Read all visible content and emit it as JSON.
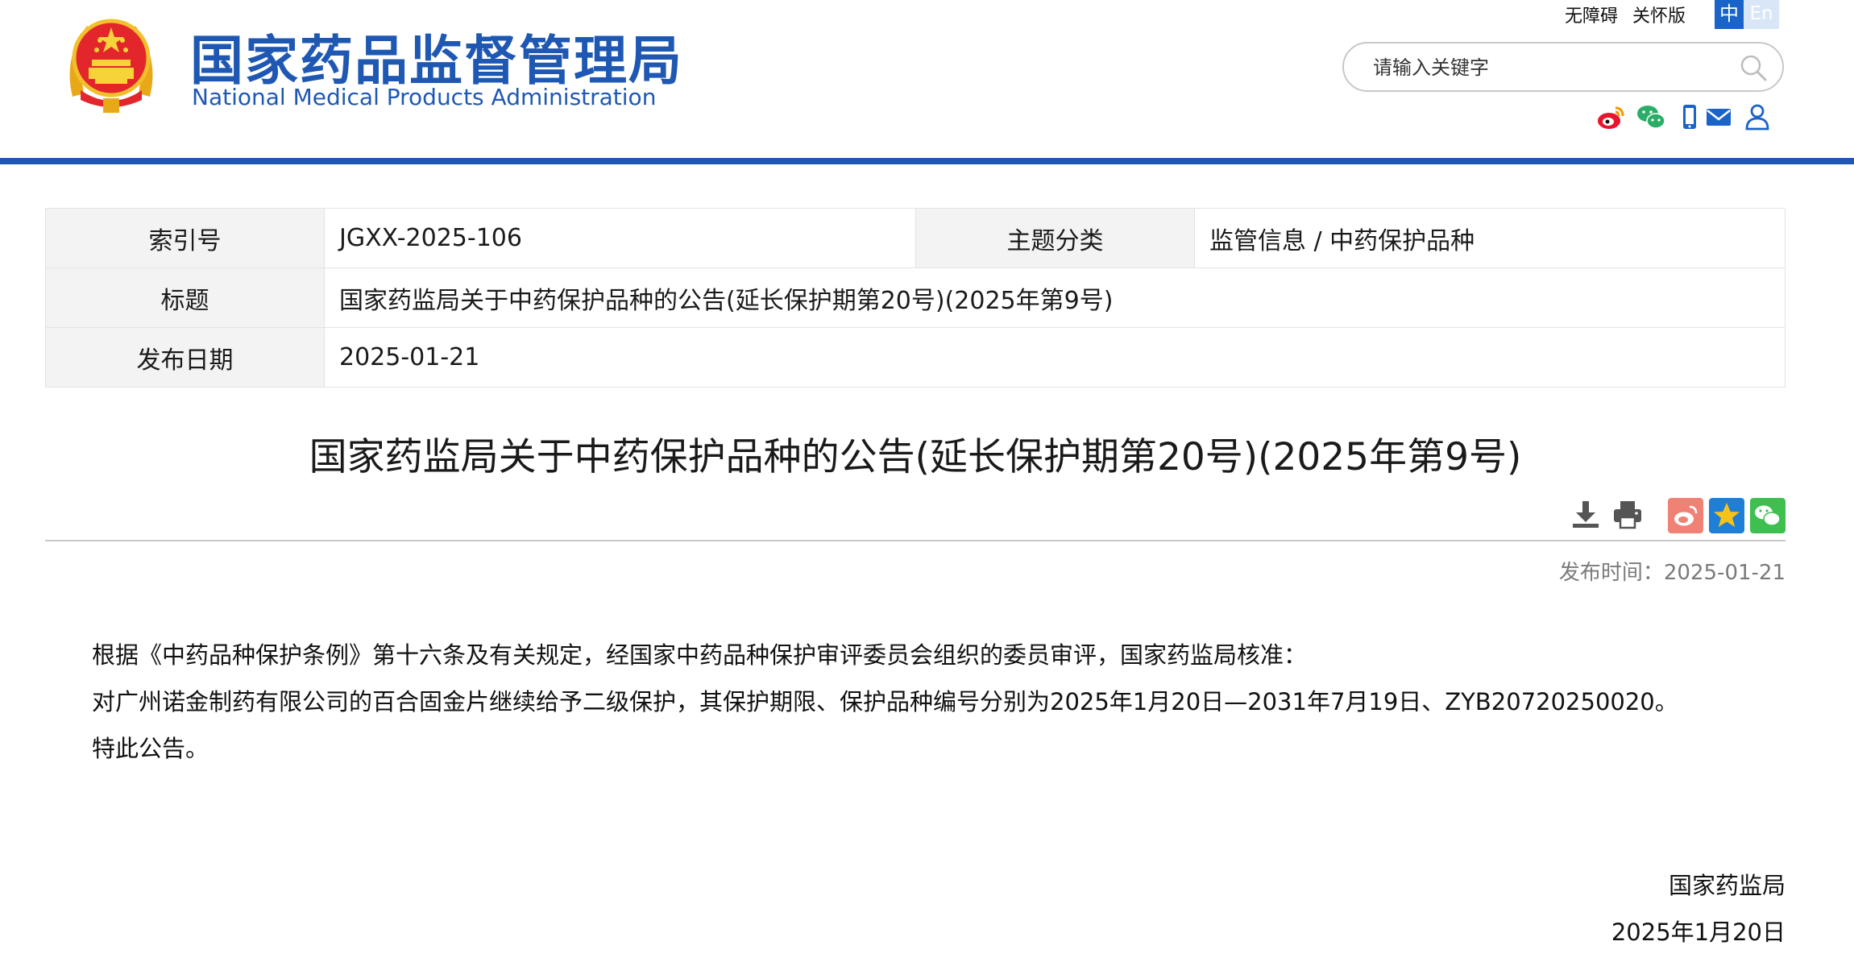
{
  "header": {
    "site_name_cn": "国家药品监督管理局",
    "site_name_en": "National Medical Products Administration",
    "accessibility_link": "无障碍",
    "elderly_link": "关怀版",
    "lang_cn": "中",
    "lang_en": "En",
    "search_placeholder": "请输入关键字",
    "social_icons": [
      "weibo-icon",
      "wechat-icon",
      "mobile-icon",
      "mail-icon",
      "user-icon"
    ],
    "brand_color": "#1f58b3"
  },
  "meta": {
    "index_label": "索引号",
    "index_value": "JGXX-2025-106",
    "topic_label": "主题分类",
    "topic_value": "监管信息 / 中药保护品种",
    "title_label": "标题",
    "title_value": "国家药监局关于中药保护品种的公告(延长保护期第20号)(2025年第9号)",
    "date_label": "发布日期",
    "date_value": "2025-01-21"
  },
  "article": {
    "title": "国家药监局关于中药保护品种的公告(延长保护期第20号)(2025年第9号)",
    "tools": [
      "download-icon",
      "print-icon",
      "share-weibo-icon",
      "favorite-star-icon",
      "share-wechat-icon"
    ],
    "pub_time": "发布时间：2025-01-21",
    "paragraphs": [
      "根据《中药品种保护条例》第十六条及有关规定，经国家中药品种保护审评委员会组织的委员审评，国家药监局核准：",
      "对广州诺金制药有限公司的百合固金片继续给予二级保护，其保护期限、保护品种编号分别为2025年1月20日—2031年7月19日、ZYB20720250020。",
      "特此公告。"
    ],
    "signature": "国家药监局",
    "sign_date": "2025年1月20日"
  }
}
